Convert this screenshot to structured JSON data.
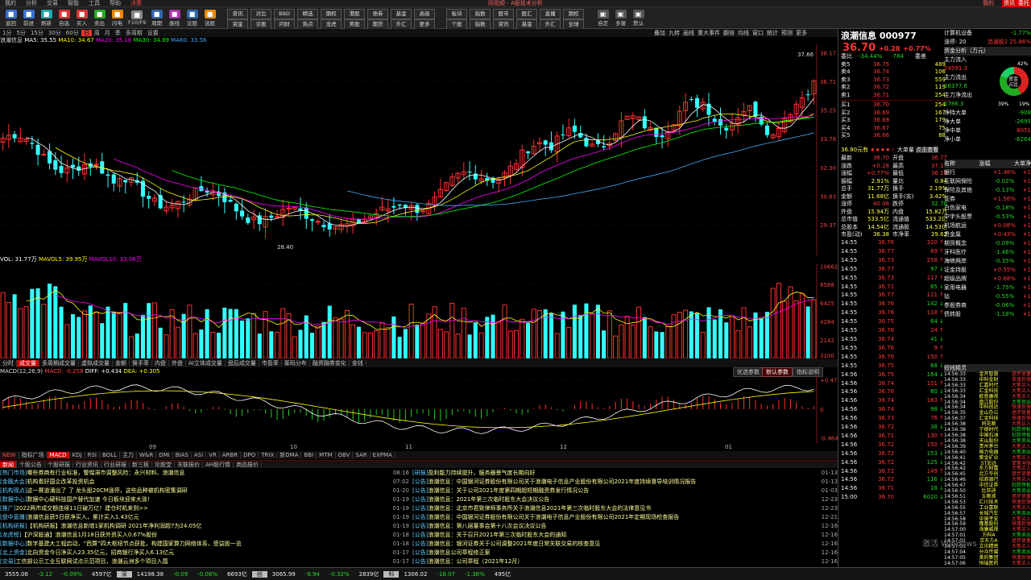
{
  "titlebar": {
    "items": [
      "我的",
      "分析",
      "交易",
      "智能",
      "工具",
      "帮助",
      "决策"
    ],
    "center": "同花顺 - A股技术分析",
    "right_items": [
      "我的",
      "资讯",
      "委托"
    ]
  },
  "toolbar": {
    "group1": [
      "返回",
      "前进",
      "刷新",
      "自选",
      "买入",
      "卖出",
      "闪电",
      "F10/F9",
      "周期",
      "画线",
      "论股",
      "选股"
    ],
    "group2": [
      [
        "资讯",
        "资金"
      ],
      [
        "对比",
        "诊股"
      ],
      [
        "BBD",
        "问财"
      ],
      [
        "精选",
        "热点"
      ],
      [
        "期权",
        "龙虎"
      ],
      [
        "港股",
        "美股"
      ],
      [
        "债券",
        "期货"
      ],
      [
        "基金",
        "外汇"
      ],
      [
        "高级",
        "更多"
      ]
    ],
    "group3": [
      [
        "板块",
        "个股"
      ],
      [
        "指数",
        "指数"
      ],
      [
        "股市",
        "资讯"
      ],
      [
        "股汇",
        "基金"
      ],
      [
        "直播",
        "外汇"
      ],
      [
        "期权",
        "全球"
      ]
    ],
    "right": [
      "自定",
      "多窗",
      "默认"
    ]
  },
  "periodbar": [
    "1分",
    "5分",
    "15分",
    "30分",
    "60分",
    "日",
    "周",
    "月",
    "季",
    "多周期",
    "设置"
  ],
  "periodbar_active": "日",
  "chart_right_menu": [
    "叠加",
    "九转",
    "画线",
    "重大事件",
    "翻倍",
    "均线",
    "窗口",
    "统计",
    "预测",
    "更多"
  ],
  "ma_legend": {
    "name": "浪潮信息",
    "ma5": "MA5: 35.55",
    "ma10": "MA10: 34.67",
    "ma20": "MA20: 35.16",
    "ma30": "MA30: 34.89",
    "ma60": "MA60: 33.56"
  },
  "price_axis": [
    "38.17",
    "36.71",
    "35.25",
    "33.78",
    "32.30",
    "30.83",
    "29.37"
  ],
  "high_label": "37.66",
  "low_label": "28.40",
  "vol_legend": {
    "vol": "VOL: 31.77万",
    "mavol5": "MAVOL5: 39.95万",
    "mavol10": "MAVOL10: 33.06万"
  },
  "vol_axis": [
    "10662",
    "8588",
    "6425",
    "4284",
    "2142",
    "3100"
  ],
  "indicator_tabs": [
    "分时",
    "成交量",
    "多周期成交量",
    "虚拟成交量",
    "金额",
    "换手率",
    "内盘",
    "外盘",
    "AI立体成交量",
    "盘后成交量",
    "市盈率",
    "筹码分布",
    "融资融券变化",
    "金钱"
  ],
  "macd_legend": {
    "name": "MACD(12,26,9)",
    "macd": "MACD: -0.258",
    "diff": "DIFF: +0.434",
    "dea": "DEA: +0.305"
  },
  "macd_buttons": [
    "优选参数",
    "默认参数",
    "指标说明"
  ],
  "macd_axis": [
    "+0.477",
    "0",
    "-0.464"
  ],
  "x_axis": [
    "09",
    "10",
    "11",
    "12",
    "01"
  ],
  "indicator_tabs2": [
    "NEW",
    "指标广场",
    "MACD",
    "KDJ",
    "RSI",
    "BOLL",
    "主力",
    "W&R",
    "DMI",
    "BIAS",
    "ASI",
    "VR",
    "ARBR",
    "DPO",
    "TRIX",
    "新DMA",
    "BBI",
    "MTM",
    "OBV",
    "SAR",
    "EXPMA"
  ],
  "news_tabs": [
    "新闻",
    "个股公告",
    "个股研报",
    "行业资讯",
    "行业研报",
    "新三板",
    "论股堂",
    "关联报价",
    "AH股行情",
    "商品报价"
  ],
  "news_left": [
    {
      "tag": "[热门市场]",
      "title": "哪些券商有行业标准，警惕滞市调整风险：永兴材料、浪潮信息",
      "time": "08:16"
    },
    {
      "tag": "[金融大会]",
      "title": "机构看好国企改革投资机会",
      "time": "07:02"
    },
    {
      "tag": "[机构观点]",
      "title": "这一赛道涌出了 了 龙头股20CM涨停，这些品种被机构密集调研",
      "time": "01-20"
    },
    {
      "tag": "[数据中心]",
      "title": "数据中心硬科技国产替代加速 今日板块迎来大涨！",
      "time": "01-19"
    },
    {
      "tag": "[推广]",
      "title": "2022两市成交额连续11日破万亿！建仓时机来到>>",
      "time": "01-19"
    },
    {
      "tag": "[盘中直播]",
      "title": "浪潮信息获5日获净买入，累计买入1.43亿元",
      "time": "01-19"
    },
    {
      "tag": "[机构研报]",
      "title": "【机构研报】浪潮信息新增1家机构调研 2021年净利润超7为24.05亿",
      "time": "01-19"
    },
    {
      "tag": "[龙虎榜]",
      "title": "【沪深股通】浪潮信息1月18日获外资买入0.67%股份",
      "time": "01-18"
    },
    {
      "tag": "[数据中心]",
      "title": "数字基建大工程启动，“西算”四大枢纽节点获批，构建国家算力网络体系，受益股一览",
      "time": "01-18"
    },
    {
      "tag": "[北上资金]",
      "title": "北向资金今日净买入23.35亿元，招商银行净买入6.13亿元",
      "time": "01-17"
    },
    {
      "tag": "[交易]",
      "title": "工信部公示工业互联网试点示范项目，浪潮云洲多个项目入围",
      "time": "01-17"
    }
  ],
  "news_right": [
    {
      "tag": "[研报]",
      "title": "盈利能力持续提升，服务器景气度长期向好",
      "time": "01-13"
    },
    {
      "tag": "[公告]",
      "title": "浪潮信息：中国银河证券股份有限公司关于浪潮电子信息产业股份有限公司2021年度持续督导培训情况报告",
      "time": "01-13"
    },
    {
      "tag": "[公告]",
      "title": "浪潮信息：关于公司2021年度第四期超短期融资券发行情况公告",
      "time": "01-03"
    },
    {
      "tag": "[公告]",
      "title": "浪潮信息：2021年第三次临时股东大会决议公告",
      "time": "12-23"
    },
    {
      "tag": "[公告]",
      "title": "浪潮信息：北京市君致律师事务所关于浪潮信息2021年第三次临时股东大会的法律意见书",
      "time": "12-23"
    },
    {
      "tag": "[公告]",
      "title": "浪潮信息：中国银河证券股份有限公司关于浪潮电子信息产业股份有限公司2021年定期现场检查报告",
      "time": "12-21"
    },
    {
      "tag": "[公告]",
      "title": "浪潮信息：第八届董事会第十八次会议决议公告",
      "time": "12-16"
    },
    {
      "tag": "[公告]",
      "title": "浪潮信息：关于召开2021年第三次临时股东大会的通知",
      "time": "12-16"
    },
    {
      "tag": "[公告]",
      "title": "浪潮信息：银河证券关于公司调整2021年度日常关联交易的核查意见",
      "time": "12-16"
    },
    {
      "tag": "[公告]",
      "title": "浪潮信息公司章程修正案",
      "time": "12-16"
    },
    {
      "tag": "[公告]",
      "title": "浪潮信息：公司章程（2021年12月）",
      "time": "12-16"
    }
  ],
  "statusbar": [
    "3555.06",
    "-3.12",
    "-0.09%",
    "4597亿",
    "深",
    "14198.38",
    "-0.09",
    "-0.06%",
    "6693亿",
    "创",
    "3065.99",
    "-9.94",
    "-0.32%",
    "2839亿",
    "科",
    "1306.02",
    "-18.07",
    "-1.36%",
    "495亿"
  ],
  "stock": {
    "name": "浪潮信息",
    "code": "000977",
    "price": "36.70",
    "change": "+0.28",
    "pct": "+0.77%"
  },
  "orderbook": {
    "header": {
      "label": "委比",
      "value": "-34.44%",
      "diff": "-784",
      "flag": "委差"
    },
    "sell": [
      {
        "label": "5",
        "price": "36.75",
        "vol": "489"
      },
      {
        "label": "4",
        "price": "36.74",
        "vol": "106"
      },
      {
        "label": "3",
        "price": "36.73",
        "vol": "559"
      },
      {
        "label": "2",
        "price": "36.72",
        "vol": "119"
      },
      {
        "label": "1",
        "price": "36.71",
        "vol": "254"
      }
    ],
    "buy": [
      {
        "label": "1",
        "price": "36.70",
        "vol": "254"
      },
      {
        "label": "2",
        "price": "36.69",
        "vol": "167"
      },
      {
        "label": "3",
        "price": "36.68",
        "vol": "179"
      },
      {
        "label": "4",
        "price": "36.67",
        "vol": "75"
      },
      {
        "label": "5",
        "price": "36.66",
        "vol": "88"
      }
    ]
  },
  "quote_header": {
    "price_label": "36.80元有",
    "stars": "★★★★☆",
    "dadan": "大单量",
    "dianji": "点击查看"
  },
  "quote": [
    [
      "最新",
      "36.70",
      "开盘",
      "36.77"
    ],
    [
      "涨跌",
      "+0.28",
      "最高",
      "37.16"
    ],
    [
      "涨幅",
      "+0.77%",
      "最低",
      "36.10"
    ],
    [
      "振幅",
      "2.91%",
      "量比",
      "0.84"
    ],
    [
      "总手",
      "31.77万",
      "换手",
      "2.19%"
    ],
    [
      "金额",
      "11.68亿",
      "换手(实)",
      "3.42%"
    ],
    [
      "涨停",
      "40.06",
      "跌停",
      "32.78"
    ],
    [
      "外盘",
      "15.94万",
      "内盘",
      "15.82万"
    ],
    [
      "总市值",
      "533.5亿",
      "流通值",
      "533.2亿"
    ],
    [
      "总股本",
      "14.54亿",
      "流通股",
      "14.53亿"
    ],
    [
      "市盈(动)",
      "36.38",
      "市净率",
      "29.62"
    ]
  ],
  "ticks": [
    [
      "14:55",
      "36.76",
      "320",
      "b"
    ],
    [
      "14:55",
      "36.77",
      "69",
      "b"
    ],
    [
      "14:55",
      "36.73",
      "258",
      "b"
    ],
    [
      "14:55",
      "36.77",
      "97",
      "s"
    ],
    [
      "14:55",
      "36.73",
      "117",
      "b"
    ],
    [
      "14:55",
      "36.72",
      "65",
      "s"
    ],
    [
      "14:55",
      "36.77",
      "121",
      "b"
    ],
    [
      "14:55",
      "36.76",
      "142",
      "s"
    ],
    [
      "14:55",
      "36.76",
      "118",
      "b"
    ],
    [
      "14:55",
      "36.75",
      "64",
      "s"
    ],
    [
      "14:55",
      "36.76",
      "24",
      "b"
    ],
    [
      "14:55",
      "36.74",
      "41",
      "s"
    ],
    [
      "14:55",
      "36.76",
      "9",
      "b"
    ],
    [
      "14:55",
      "36.76",
      "150",
      "b"
    ],
    [
      "14:55",
      "36.75",
      "68",
      "s"
    ],
    [
      "14:56",
      "36.75",
      "164",
      "s"
    ],
    [
      "14:56",
      "36.74",
      "101",
      "b"
    ],
    [
      "14:56",
      "36.76",
      "80",
      "s"
    ],
    [
      "14:56",
      "36.74",
      "163",
      "b"
    ],
    [
      "14:56",
      "36.74",
      "98",
      "s"
    ],
    [
      "14:56",
      "36.73",
      "76",
      "b"
    ],
    [
      "14:56",
      "36.72",
      "38",
      "s"
    ],
    [
      "14:56",
      "36.71",
      "130",
      "b"
    ],
    [
      "14:56",
      "36.72",
      "150",
      "b"
    ],
    [
      "14:56",
      "36.72",
      "153",
      "s"
    ],
    [
      "14:56",
      "36.72",
      "125",
      "s"
    ],
    [
      "14:56",
      "36.72",
      "149",
      "b"
    ],
    [
      "14:56",
      "36.72",
      "116",
      "s"
    ],
    [
      "14:56",
      "36.71",
      "18",
      "s"
    ],
    [
      "15:00",
      "36.70",
      "6020",
      "s"
    ]
  ],
  "fund_flow": {
    "title": "计算机设备",
    "pct": "-1.77%",
    "sub1": "涨停: 20",
    "sub2": "流通股2 25.86%",
    "header": "资金分析（万元）",
    "rows": [
      [
        "主力流入",
        "24591.3"
      ],
      [
        "主力流出",
        "26377.6"
      ],
      [
        "主力净流出",
        "1786.3"
      ]
    ],
    "donut_center": [
      "资金",
      "占比"
    ],
    "donut_labels": [
      "42%",
      "39%",
      "19%"
    ],
    "net_rows": [
      [
        "净特大单",
        "-908"
      ],
      [
        "净大单",
        "-2695"
      ],
      [
        "净中单",
        "8051"
      ],
      [
        "净小单",
        "-6264"
      ]
    ]
  },
  "sector_header": [
    "名称",
    "涨幅",
    "大单净"
  ],
  "sectors": [
    [
      "银行",
      "+1.48%",
      "+1"
    ],
    [
      "互联网保险",
      "-0.02%",
      "+1"
    ],
    [
      "保险及其他",
      "-0.13%",
      "+1"
    ],
    [
      "证券",
      "+1.56%",
      "+1"
    ],
    [
      "白色家电",
      "-0.18%",
      "+1"
    ],
    [
      "中字头股票",
      "-0.53%",
      "+1"
    ],
    [
      "机场航运",
      "+0.08%",
      "+1"
    ],
    [
      "贵金属",
      "+0.43%",
      "+1"
    ],
    [
      "期货概念",
      "-0.09%",
      "+1"
    ],
    [
      "牙科医疗",
      "-1.46%",
      "+1"
    ],
    [
      "海峡两岸",
      "-0.35%",
      "+1"
    ],
    [
      "证金持股",
      "+0.55%",
      "+1"
    ],
    [
      "超级品牌",
      "+0.68%",
      "+1"
    ],
    [
      "家用电器",
      "-1.75%",
      "+1"
    ],
    [
      "钴",
      "-0.55%",
      "+1"
    ],
    [
      "参股券商",
      "-0.06%",
      "+1"
    ],
    [
      "债转股",
      "-1.18%",
      "+1"
    ]
  ],
  "ai_header": "短线精灵",
  "ai_rows": [
    [
      "14:56:33",
      "金开智慧",
      "逐步放量"
    ],
    [
      "14:56:33",
      "中科金财",
      "快速反弹"
    ],
    [
      "14:56:33",
      "汇嘉时代",
      "大笔买入"
    ],
    [
      "14:56:33",
      "汇金科技",
      "大笔买入"
    ],
    [
      "14:56:34",
      "欧普康视",
      "大笔买入"
    ],
    [
      "14:56:34",
      "盘江股份",
      "大笔卖出"
    ],
    [
      "14:56:34",
      "中科创达",
      "快速反弹"
    ],
    [
      "14:56:35",
      "金山办公",
      "逐步放量"
    ],
    [
      "14:56:37",
      "汇金科技",
      "快速反弹"
    ],
    [
      "14:56:38",
      "同花顺",
      "大笔买入"
    ],
    [
      "14:56:38",
      "宁德时代",
      "封跌停板"
    ],
    [
      "14:56:38",
      "中国石油",
      "封跌停板"
    ],
    [
      "14:56:38",
      "天山股份",
      "大笔卖出"
    ],
    [
      "14:56:39",
      "贵州茅台",
      "大笔买入"
    ],
    [
      "14:56:40",
      "格力电器",
      "大笔卖出"
    ],
    [
      "14:56:41",
      "紫金矿业",
      "大笔买入"
    ],
    [
      "14:56:42",
      "ST宏达",
      "单笔冲涨"
    ],
    [
      "14:56:42",
      "东方财富",
      "大笔买入"
    ],
    [
      "14:56:45",
      "北方华创",
      "逐步放量"
    ],
    [
      "14:56:46",
      "招商银行",
      "大笔买入"
    ],
    [
      "14:56:47",
      "中信证券",
      "封跌停板"
    ],
    [
      "14:56:50",
      "比亚迪",
      "大笔卖出"
    ],
    [
      "14:56:51",
      "五粮液",
      "逐步放量"
    ],
    [
      "14:56:53",
      "汇川技术",
      "快速反弹"
    ],
    [
      "14:56:55",
      "工业富联",
      "大笔买入"
    ],
    [
      "14:56:57",
      "长城汽车",
      "大笔卖出"
    ],
    [
      "14:56:58",
      "中国平安",
      "大笔买入"
    ],
    [
      "14:56:59",
      "隆基股份",
      "快速反弹"
    ],
    [
      "14:57:00",
      "海康威视",
      "大笔买入"
    ],
    [
      "14:57:01",
      "万科A",
      "大笔卖出"
    ],
    [
      "14:57:02",
      "京东方A",
      "逐步放量"
    ],
    [
      "14:57:03",
      "立讯精密",
      "大笔买入"
    ],
    [
      "14:57:04",
      "分众传媒",
      "大笔卖出"
    ],
    [
      "14:57:05",
      "美的集团",
      "快速反弹"
    ],
    [
      "14:57:06",
      "恒瑞医药",
      "大笔买入"
    ]
  ],
  "windows_watermark": "激活 Windows"
}
